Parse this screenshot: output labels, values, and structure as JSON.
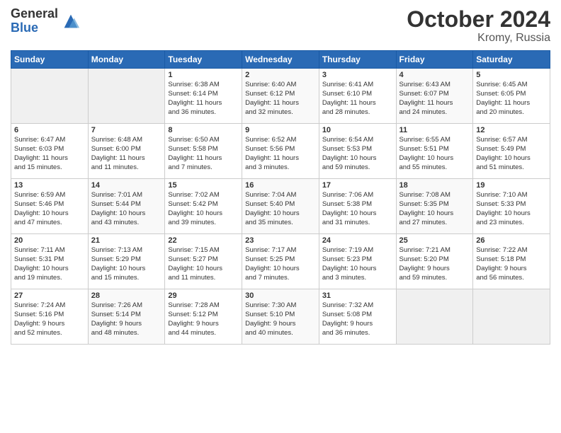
{
  "logo": {
    "general": "General",
    "blue": "Blue"
  },
  "title": {
    "month_year": "October 2024",
    "location": "Kromy, Russia"
  },
  "headers": [
    "Sunday",
    "Monday",
    "Tuesday",
    "Wednesday",
    "Thursday",
    "Friday",
    "Saturday"
  ],
  "weeks": [
    [
      {
        "day": "",
        "info": ""
      },
      {
        "day": "",
        "info": ""
      },
      {
        "day": "1",
        "info": "Sunrise: 6:38 AM\nSunset: 6:14 PM\nDaylight: 11 hours\nand 36 minutes."
      },
      {
        "day": "2",
        "info": "Sunrise: 6:40 AM\nSunset: 6:12 PM\nDaylight: 11 hours\nand 32 minutes."
      },
      {
        "day": "3",
        "info": "Sunrise: 6:41 AM\nSunset: 6:10 PM\nDaylight: 11 hours\nand 28 minutes."
      },
      {
        "day": "4",
        "info": "Sunrise: 6:43 AM\nSunset: 6:07 PM\nDaylight: 11 hours\nand 24 minutes."
      },
      {
        "day": "5",
        "info": "Sunrise: 6:45 AM\nSunset: 6:05 PM\nDaylight: 11 hours\nand 20 minutes."
      }
    ],
    [
      {
        "day": "6",
        "info": "Sunrise: 6:47 AM\nSunset: 6:03 PM\nDaylight: 11 hours\nand 15 minutes."
      },
      {
        "day": "7",
        "info": "Sunrise: 6:48 AM\nSunset: 6:00 PM\nDaylight: 11 hours\nand 11 minutes."
      },
      {
        "day": "8",
        "info": "Sunrise: 6:50 AM\nSunset: 5:58 PM\nDaylight: 11 hours\nand 7 minutes."
      },
      {
        "day": "9",
        "info": "Sunrise: 6:52 AM\nSunset: 5:56 PM\nDaylight: 11 hours\nand 3 minutes."
      },
      {
        "day": "10",
        "info": "Sunrise: 6:54 AM\nSunset: 5:53 PM\nDaylight: 10 hours\nand 59 minutes."
      },
      {
        "day": "11",
        "info": "Sunrise: 6:55 AM\nSunset: 5:51 PM\nDaylight: 10 hours\nand 55 minutes."
      },
      {
        "day": "12",
        "info": "Sunrise: 6:57 AM\nSunset: 5:49 PM\nDaylight: 10 hours\nand 51 minutes."
      }
    ],
    [
      {
        "day": "13",
        "info": "Sunrise: 6:59 AM\nSunset: 5:46 PM\nDaylight: 10 hours\nand 47 minutes."
      },
      {
        "day": "14",
        "info": "Sunrise: 7:01 AM\nSunset: 5:44 PM\nDaylight: 10 hours\nand 43 minutes."
      },
      {
        "day": "15",
        "info": "Sunrise: 7:02 AM\nSunset: 5:42 PM\nDaylight: 10 hours\nand 39 minutes."
      },
      {
        "day": "16",
        "info": "Sunrise: 7:04 AM\nSunset: 5:40 PM\nDaylight: 10 hours\nand 35 minutes."
      },
      {
        "day": "17",
        "info": "Sunrise: 7:06 AM\nSunset: 5:38 PM\nDaylight: 10 hours\nand 31 minutes."
      },
      {
        "day": "18",
        "info": "Sunrise: 7:08 AM\nSunset: 5:35 PM\nDaylight: 10 hours\nand 27 minutes."
      },
      {
        "day": "19",
        "info": "Sunrise: 7:10 AM\nSunset: 5:33 PM\nDaylight: 10 hours\nand 23 minutes."
      }
    ],
    [
      {
        "day": "20",
        "info": "Sunrise: 7:11 AM\nSunset: 5:31 PM\nDaylight: 10 hours\nand 19 minutes."
      },
      {
        "day": "21",
        "info": "Sunrise: 7:13 AM\nSunset: 5:29 PM\nDaylight: 10 hours\nand 15 minutes."
      },
      {
        "day": "22",
        "info": "Sunrise: 7:15 AM\nSunset: 5:27 PM\nDaylight: 10 hours\nand 11 minutes."
      },
      {
        "day": "23",
        "info": "Sunrise: 7:17 AM\nSunset: 5:25 PM\nDaylight: 10 hours\nand 7 minutes."
      },
      {
        "day": "24",
        "info": "Sunrise: 7:19 AM\nSunset: 5:23 PM\nDaylight: 10 hours\nand 3 minutes."
      },
      {
        "day": "25",
        "info": "Sunrise: 7:21 AM\nSunset: 5:20 PM\nDaylight: 9 hours\nand 59 minutes."
      },
      {
        "day": "26",
        "info": "Sunrise: 7:22 AM\nSunset: 5:18 PM\nDaylight: 9 hours\nand 56 minutes."
      }
    ],
    [
      {
        "day": "27",
        "info": "Sunrise: 7:24 AM\nSunset: 5:16 PM\nDaylight: 9 hours\nand 52 minutes."
      },
      {
        "day": "28",
        "info": "Sunrise: 7:26 AM\nSunset: 5:14 PM\nDaylight: 9 hours\nand 48 minutes."
      },
      {
        "day": "29",
        "info": "Sunrise: 7:28 AM\nSunset: 5:12 PM\nDaylight: 9 hours\nand 44 minutes."
      },
      {
        "day": "30",
        "info": "Sunrise: 7:30 AM\nSunset: 5:10 PM\nDaylight: 9 hours\nand 40 minutes."
      },
      {
        "day": "31",
        "info": "Sunrise: 7:32 AM\nSunset: 5:08 PM\nDaylight: 9 hours\nand 36 minutes."
      },
      {
        "day": "",
        "info": ""
      },
      {
        "day": "",
        "info": ""
      }
    ]
  ]
}
